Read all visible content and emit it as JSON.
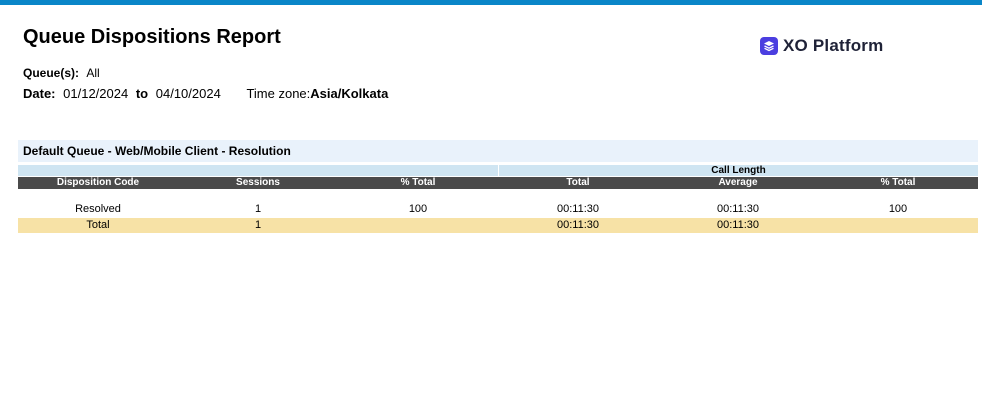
{
  "report": {
    "title": "Queue Dispositions Report",
    "brand": "XO Platform",
    "queues_label": "Queue(s):",
    "queues_value": "All",
    "date_label": "Date:",
    "date_from": "01/12/2024",
    "date_to_label": "to",
    "date_to": "04/10/2024",
    "timezone_label": "Time zone:",
    "timezone_value": "Asia/Kolkata"
  },
  "section": {
    "title": "Default Queue - Web/Mobile Client - Resolution",
    "group_header": "Call Length",
    "columns": [
      "Disposition Code",
      "Sessions",
      "% Total",
      "Total",
      "Average",
      "% Total"
    ],
    "rows": [
      [
        "Resolved",
        "1",
        "100",
        "00:11:30",
        "00:11:30",
        "100"
      ]
    ],
    "total_row": [
      "Total",
      "1",
      "",
      "00:11:30",
      "00:11:30",
      ""
    ]
  },
  "colors": {
    "top_bar": "#0a86c8",
    "header_bg": "#4a4a4a",
    "total_row_bg": "#f7e2a6",
    "brand_icon": "#4b3ee0"
  },
  "icons": {
    "brand": "stack-layers-icon"
  }
}
